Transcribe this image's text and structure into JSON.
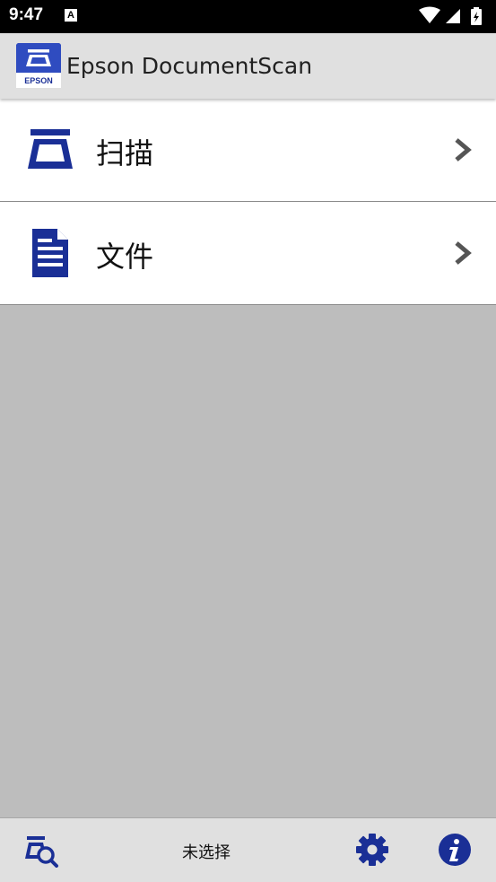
{
  "status_bar": {
    "time": "9:47",
    "notification_icon": "A",
    "icons": [
      "wifi-icon",
      "signal-icon",
      "battery-icon"
    ]
  },
  "app_bar": {
    "title": "Epson DocumentScan",
    "logo_text": "EPSON",
    "logo_icon": "scanner-icon"
  },
  "menu": {
    "items": [
      {
        "label": "扫描",
        "icon": "scanner-icon",
        "trailing_icon": "chevron-right-icon"
      },
      {
        "label": "文件",
        "icon": "document-icon",
        "trailing_icon": "chevron-right-icon"
      }
    ]
  },
  "bottom_bar": {
    "scanner_status": "未选择",
    "left_icon": "scanner-search-icon",
    "settings_icon": "gear-icon",
    "info_icon": "info-icon"
  },
  "colors": {
    "brand_blue": "#1a2f96",
    "app_bar_bg": "#e0e0e0",
    "content_bg": "#bdbdbd",
    "chevron": "#555555"
  }
}
